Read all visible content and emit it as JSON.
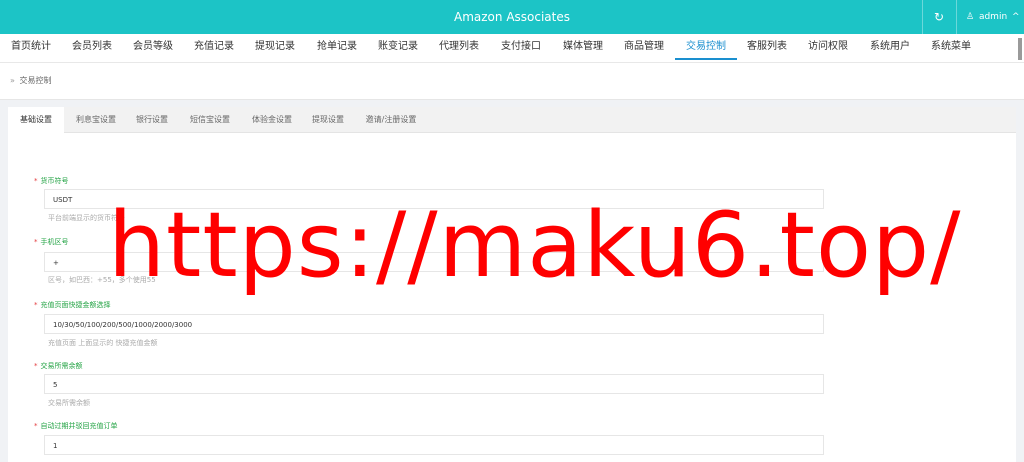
{
  "header": {
    "title": "Amazon Associates",
    "refresh_icon": "↻",
    "user_icon": "♙",
    "user_name": "admin",
    "user_chevron": "^"
  },
  "nav": {
    "items": [
      "首页统计",
      "会员列表",
      "会员等级",
      "充值记录",
      "提现记录",
      "抢单记录",
      "账变记录",
      "代理列表",
      "支付接口",
      "媒体管理",
      "商品管理",
      "交易控制",
      "客服列表",
      "访问权限",
      "系统用户",
      "系统菜单"
    ],
    "active": "交易控制"
  },
  "breadcrumb": {
    "chevron": "»",
    "current": "交易控制"
  },
  "tabs": {
    "items": [
      "基础设置",
      "利息宝设置",
      "银行设置",
      "短信宝设置",
      "体验金设置",
      "提现设置",
      "邀请/注册设置"
    ],
    "active": "基础设置"
  },
  "form": {
    "fields": [
      {
        "label": "货币符号",
        "value": "USDT",
        "help": "平台前端显示的货币符号"
      },
      {
        "label": "手机区号",
        "value": "+",
        "help": "区号，如巴西：+55，多个使用55"
      },
      {
        "label": "充值页面快捷金额选择",
        "value": "10/30/50/100/200/500/1000/2000/3000",
        "help": "充值页面 上面显示的 快捷充值金额"
      },
      {
        "label": "交易所需余额",
        "value": "5",
        "help": "交易所需余额"
      },
      {
        "label": "自动过期并驳回充值订单",
        "value": "1",
        "help": ""
      }
    ]
  },
  "watermark": "https://maku6.top/",
  "colors": {
    "header_bg": "#1cc4c6",
    "nav_active": "#1a8fcf",
    "label_green": "#23a344",
    "required_star": "#e4393c",
    "watermark": "#ff0000"
  }
}
